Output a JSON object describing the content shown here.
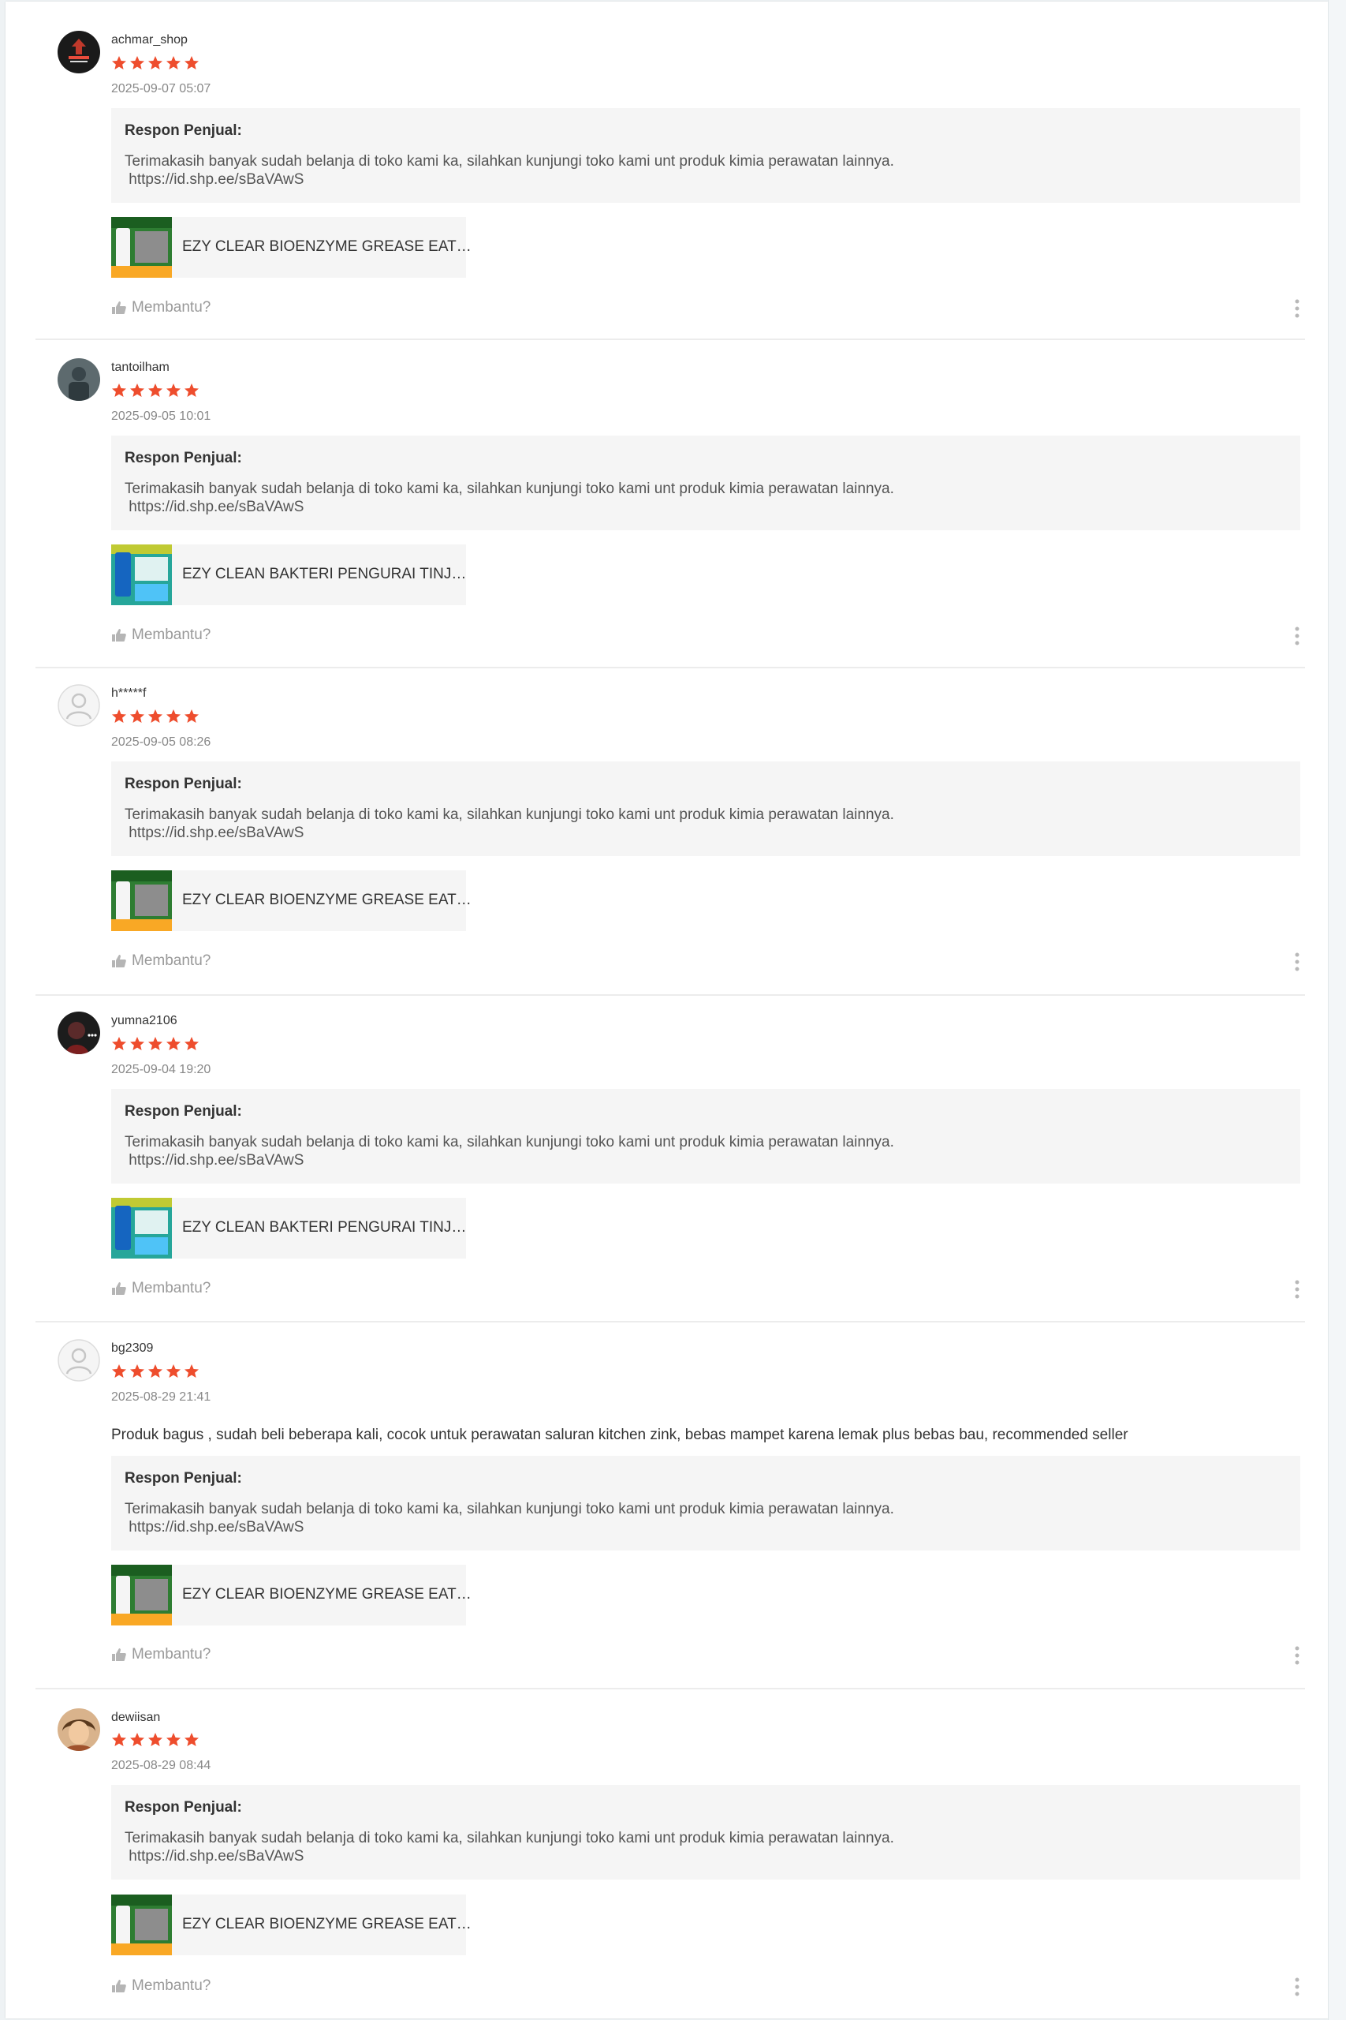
{
  "colors": {
    "star": "#ee4d2d",
    "response_bg": "#f5f5f5",
    "muted": "#999999"
  },
  "response_title": "Respon Penjual:",
  "helpful_label": "Membantu?",
  "reviews": [
    {
      "username": "achmar_shop",
      "rating": 5,
      "date": "2025-09-07 05:07",
      "comment": "",
      "response": "Terimakasih banyak sudah belanja di toko kami ka, silahkan kunjungi toko kami unt produk kimia perawatan lainnya.\n https://id.shp.ee/sBaVAwS",
      "product_name": "EZY CLEAR BIOENZYME GREASE EAT…"
    },
    {
      "username": "tantoilham",
      "rating": 5,
      "date": "2025-09-05 10:01",
      "comment": "",
      "response": "Terimakasih banyak sudah belanja di toko kami ka, silahkan kunjungi toko kami unt produk kimia perawatan lainnya.\n https://id.shp.ee/sBaVAwS",
      "product_name": "EZY CLEAN BAKTERI PENGURAI TINJ…"
    },
    {
      "username": "h*****f",
      "rating": 5,
      "date": "2025-09-05 08:26",
      "comment": "",
      "response": "Terimakasih banyak sudah belanja di toko kami ka, silahkan kunjungi toko kami unt produk kimia perawatan lainnya.\n https://id.shp.ee/sBaVAwS",
      "product_name": "EZY CLEAR BIOENZYME GREASE EAT…"
    },
    {
      "username": "yumna2106",
      "rating": 5,
      "date": "2025-09-04 19:20",
      "comment": "",
      "response": "Terimakasih banyak sudah belanja di toko kami ka, silahkan kunjungi toko kami unt produk kimia perawatan lainnya.\n https://id.shp.ee/sBaVAwS",
      "product_name": "EZY CLEAN BAKTERI PENGURAI TINJ…"
    },
    {
      "username": "bg2309",
      "rating": 5,
      "date": "2025-08-29 21:41",
      "comment": "Produk bagus , sudah beli beberapa kali, cocok untuk perawatan saluran kitchen zink, bebas mampet karena lemak plus bebas bau, recommended seller",
      "response": "Terimakasih banyak sudah belanja di toko kami ka, silahkan kunjungi toko kami unt produk kimia perawatan lainnya.\n https://id.shp.ee/sBaVAwS",
      "product_name": "EZY CLEAR BIOENZYME GREASE EAT…"
    },
    {
      "username": "dewiisan",
      "rating": 5,
      "date": "2025-08-29 08:44",
      "comment": "",
      "response": "Terimakasih banyak sudah belanja di toko kami ka, silahkan kunjungi toko kami unt produk kimia perawatan lainnya.\n https://id.shp.ee/sBaVAwS",
      "product_name": "EZY CLEAR BIOENZYME GREASE EAT…"
    }
  ]
}
